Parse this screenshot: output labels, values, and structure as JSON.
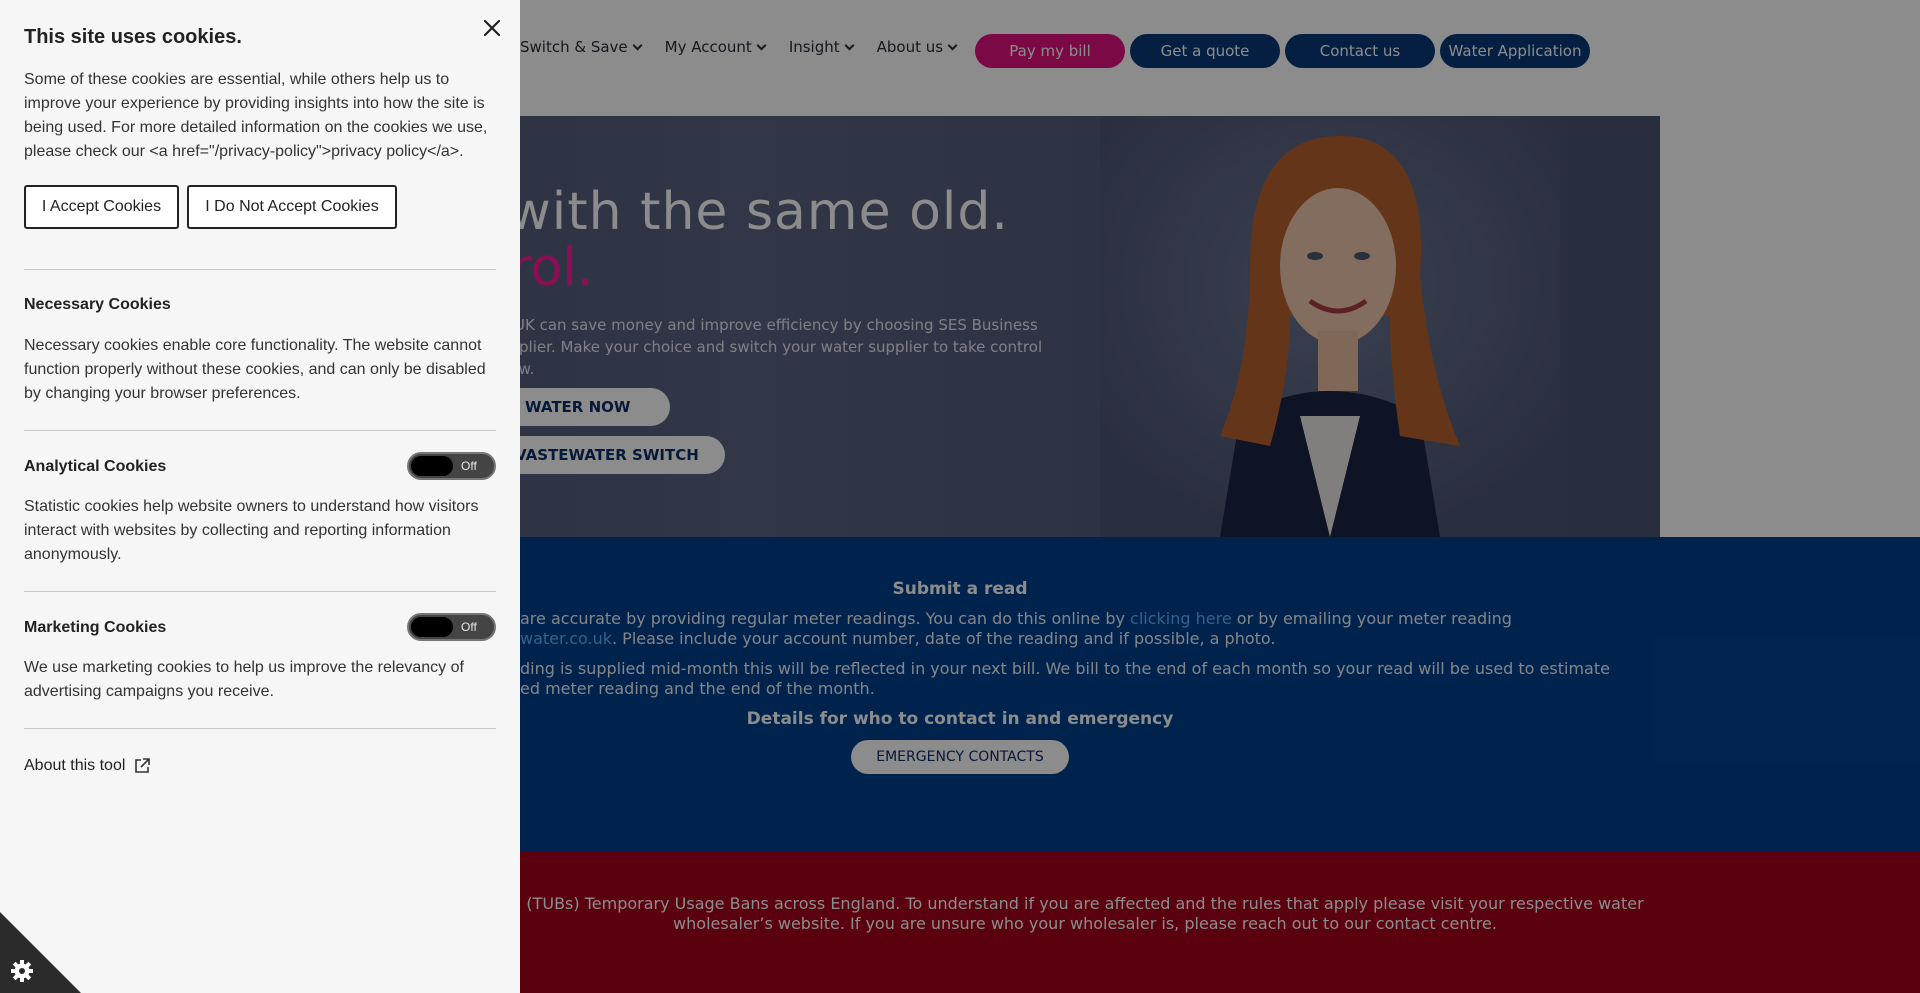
{
  "site": {
    "nav": [
      {
        "label": "Switch & Save"
      },
      {
        "label": "My Account"
      },
      {
        "label": "Insight"
      },
      {
        "label": "About us"
      }
    ],
    "buttons": {
      "pay": "Pay my bill",
      "quote": "Get a quote",
      "contact": "Contact us",
      "apply": "Water Application"
    },
    "hero": {
      "title_line1": "ck with the same old.",
      "title_line2": "trol.",
      "text": "e UK can save money and improve efficiency by choosing SES Business upplier. Make your choice and switch your water supplier to take control now.",
      "btn1": "WATER NOW",
      "btn2": "VASTEWATER SWITCH"
    },
    "read": {
      "title": "Submit a read",
      "p1_a": "are accurate by providing regular meter readings.  You can do this online by ",
      "p1_link": "clicking here",
      "p1_b": " or by emailing your meter reading",
      "p1_link2": "water.co.uk",
      "p1_c": ".  Please include your account number, date of the reading and if possible, a photo.",
      "p2": "ding is supplied mid-month this will be reflected in your next bill.  We bill to the end of each month so your read will be used to estimate ed meter reading and the end of the month.",
      "contact_title": "Details for who to contact in and emergency",
      "emergency_btn": "EMERGENCY CONTACTS"
    },
    "tubs": {
      "text": "(TUBs) Temporary Usage Bans across England. To understand if you are affected and the rules that apply please visit your respective water wholesaler’s website. If you are unsure who your wholesaler is, please reach out to our contact centre."
    },
    "colors": {
      "pink": "#e0127e",
      "navy": "#0a3a7a",
      "blue_section": "#00408f",
      "red_section": "#a6001a"
    }
  },
  "cookie_panel": {
    "title": "This site uses cookies.",
    "intro": "Some of these cookies are essential, while others help us to improve your experience by providing insights into how the site is being used. For more detailed information on the cookies we use, please check our <a href=\"/privacy-policy\">privacy policy</a>.",
    "accept_label": "I Accept Cookies",
    "reject_label": "I Do Not Accept Cookies",
    "necessary": {
      "title": "Necessary Cookies",
      "text": "Necessary cookies enable core functionality. The website cannot function properly without these cookies, and can only be disabled by changing your browser preferences."
    },
    "analytical": {
      "title": "Analytical Cookies",
      "toggle": "Off",
      "text": "Statistic cookies help website owners to understand how visitors interact with websites by collecting and reporting information anonymously."
    },
    "marketing": {
      "title": "Marketing Cookies",
      "toggle": "Off",
      "text": "We use marketing cookies to help us improve the relevancy of advertising campaigns you receive."
    },
    "about_label": "About this tool",
    "icons": {
      "close": "close-icon",
      "external": "external-link-icon",
      "settings": "gear-icon"
    }
  }
}
